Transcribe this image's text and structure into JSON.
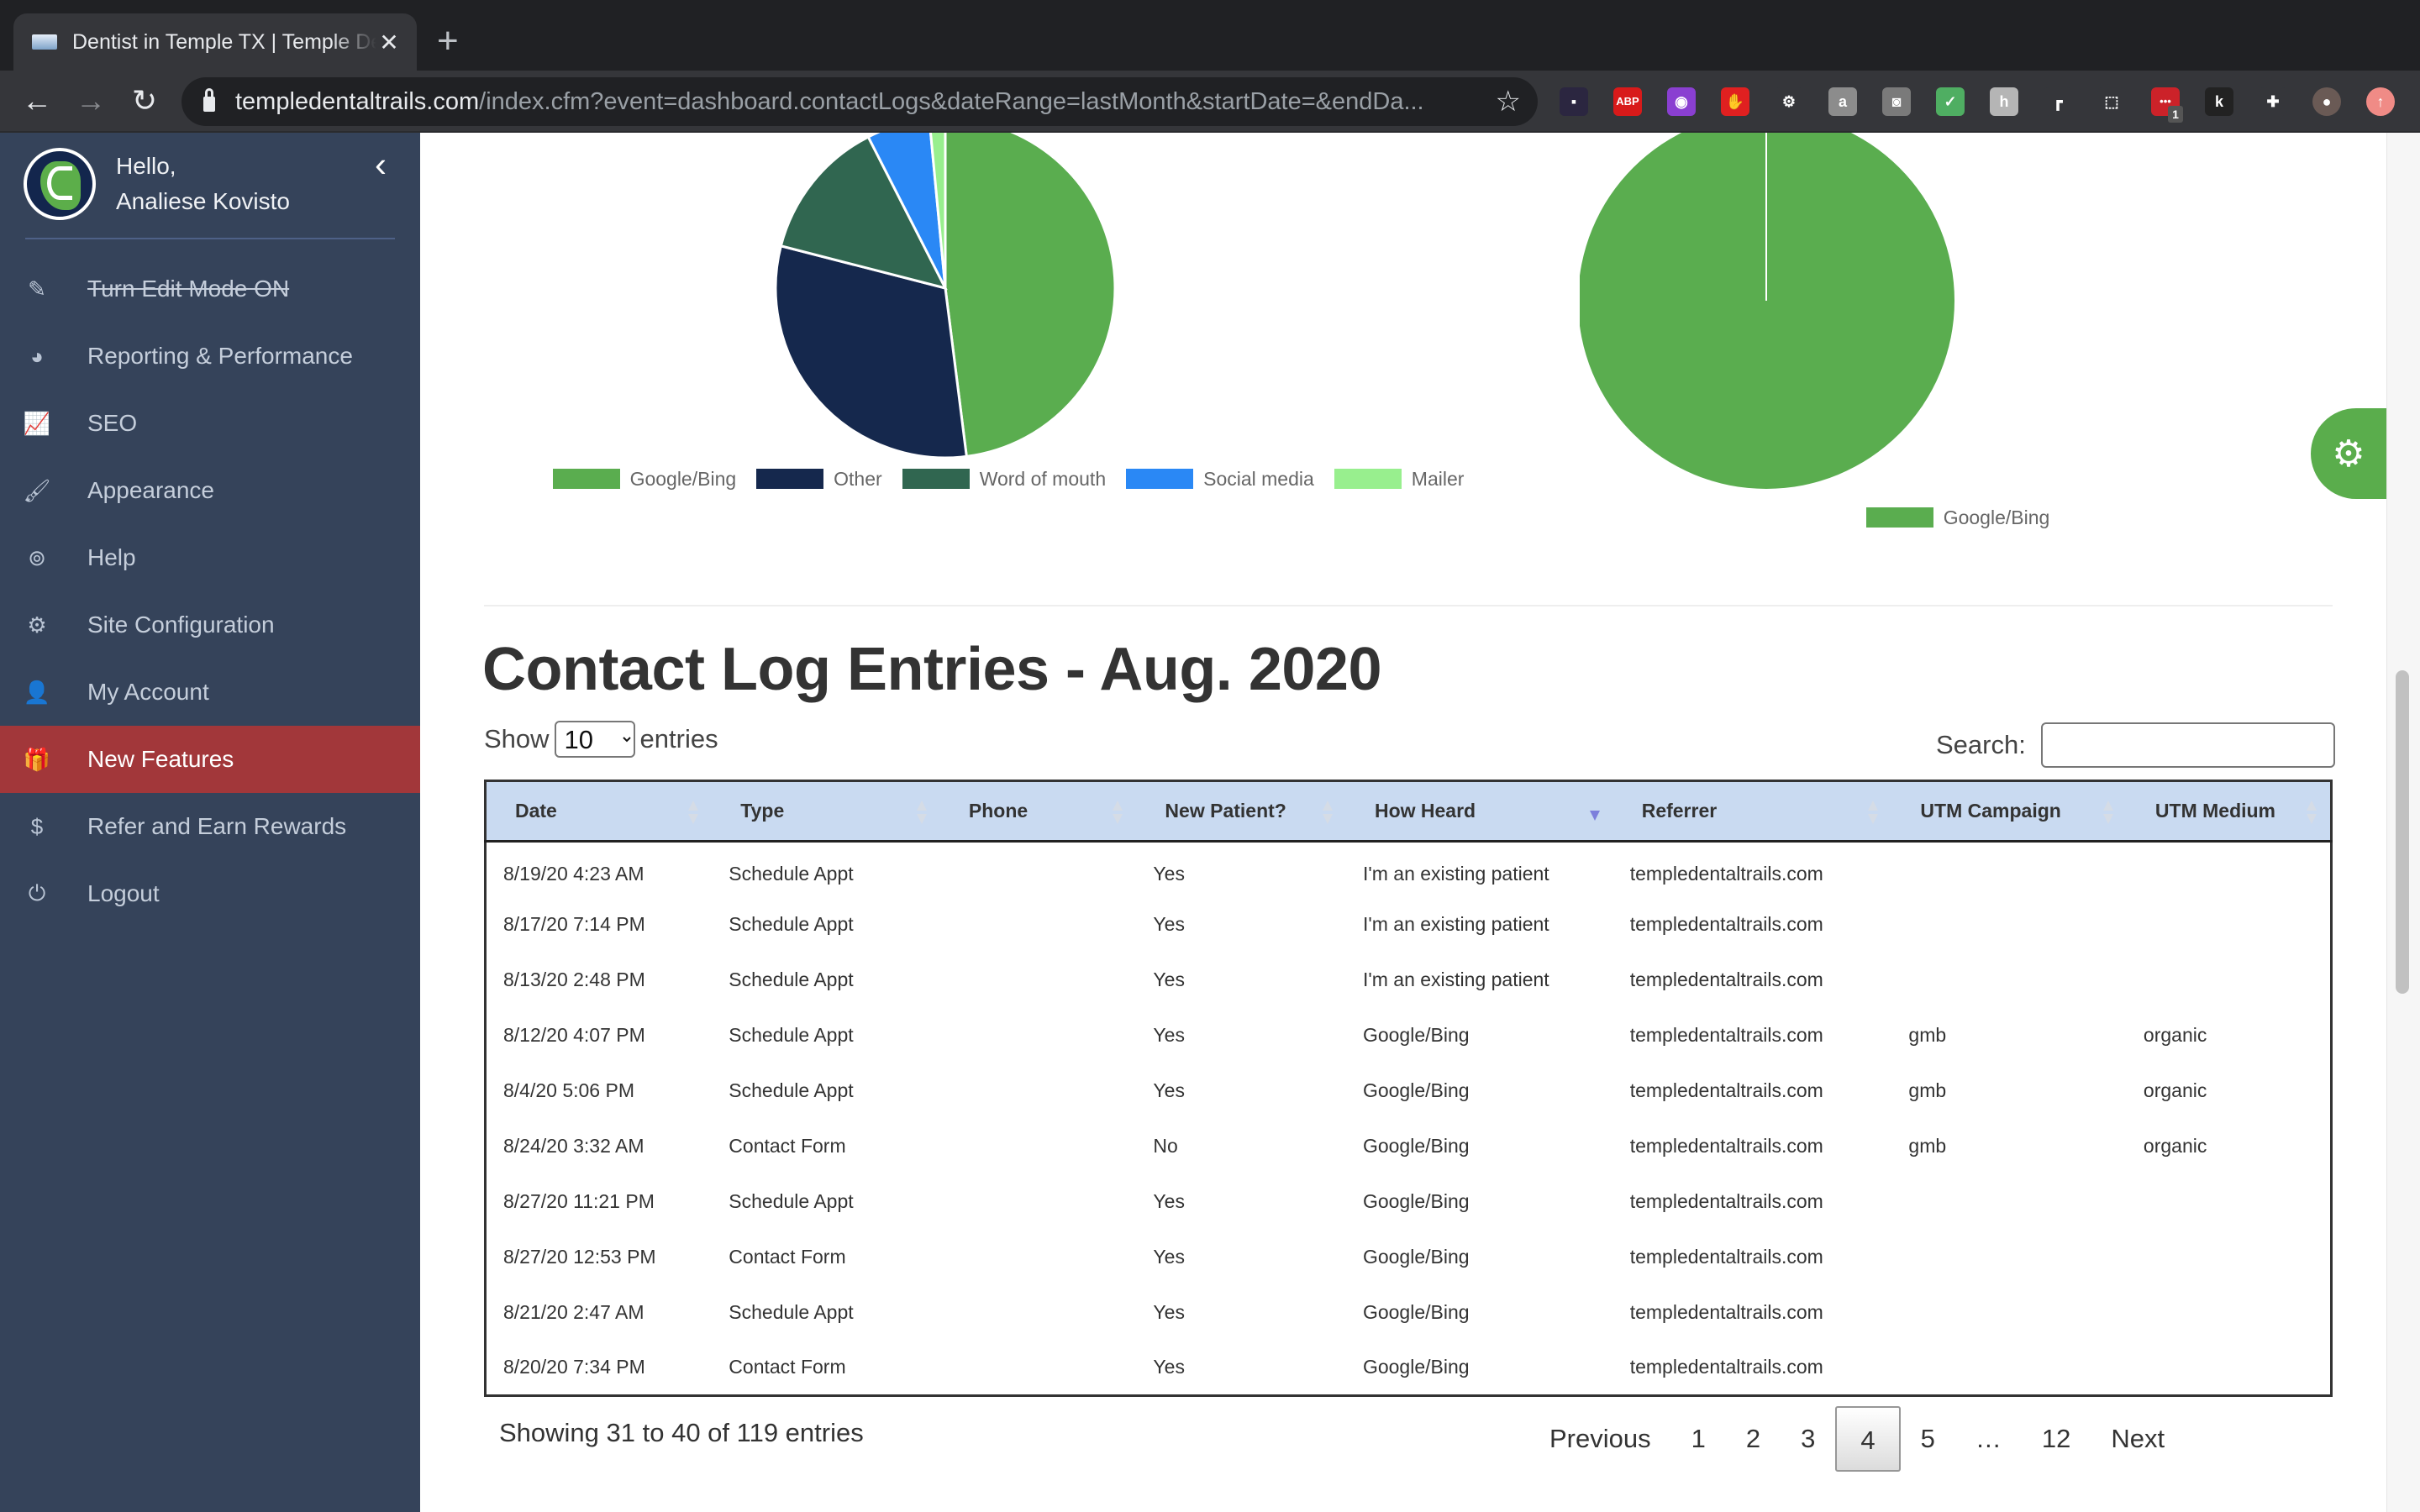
{
  "browser": {
    "tab_title": "Dentist in Temple TX | Temple Dental Trails",
    "tab_close": "✕",
    "new_tab": "+",
    "url_host": "templedentaltrails.com",
    "url_path": "/index.cfm?event=dashboard.contactLogs&dateRange=lastMonth&startDate=&endDa...",
    "back": "←",
    "forward": "→",
    "reload": "↻",
    "bookmark": "☆",
    "extensions": [
      {
        "name": "screen-recorder-icon",
        "glyph": "▪",
        "color": "#2b2640"
      },
      {
        "name": "adblock-plus-icon",
        "glyph": "ABP",
        "color": "#d81a1a"
      },
      {
        "name": "color-picker-icon",
        "glyph": "◉",
        "color": "#8a3fd1"
      },
      {
        "name": "stop-hand-icon",
        "glyph": "✋",
        "color": "#e02020"
      },
      {
        "name": "gear-extension-icon",
        "glyph": "⚙",
        "color": "#35363a"
      },
      {
        "name": "translate-icon",
        "glyph": "a",
        "color": "#8c8c8c"
      },
      {
        "name": "camera-icon",
        "glyph": "◙",
        "color": "#7a7a7a"
      },
      {
        "name": "shield-check-icon",
        "glyph": "✓",
        "color": "#4fae62"
      },
      {
        "name": "script-h-icon",
        "glyph": "h",
        "color": "#b5b5b5"
      },
      {
        "name": "signpost-icon",
        "glyph": "┏",
        "color": "#35363a"
      },
      {
        "name": "selection-icon",
        "glyph": "⬚",
        "color": "#35363a"
      },
      {
        "name": "lastpass-icon",
        "glyph": "•••",
        "color": "#cc2229",
        "badge": "1"
      },
      {
        "name": "k-extension-icon",
        "glyph": "k",
        "color": "#222"
      },
      {
        "name": "puzzle-extensions-icon",
        "glyph": "✚",
        "color": "#35363a"
      },
      {
        "name": "profile-avatar-icon",
        "glyph": "●",
        "color": "#6a5a55"
      },
      {
        "name": "update-arrow-icon",
        "glyph": "↑",
        "color": "#f08b86"
      }
    ]
  },
  "sidebar": {
    "greeting": "Hello,",
    "user_name": "Analiese Kovisto",
    "collapse": "‹",
    "items": [
      {
        "label": "Turn Edit Mode ON",
        "icon": "✎",
        "icon_name": "pencil-icon",
        "strike": true
      },
      {
        "label": "Reporting & Performance",
        "icon": "◕",
        "icon_name": "pie-chart-icon"
      },
      {
        "label": "SEO",
        "icon": "📈",
        "icon_name": "line-chart-icon"
      },
      {
        "label": "Appearance",
        "icon": "🖌",
        "icon_name": "paint-brush-icon"
      },
      {
        "label": "Help",
        "icon": "⊚",
        "icon_name": "life-ring-icon"
      },
      {
        "label": "Site Configuration",
        "icon": "⚙",
        "icon_name": "gear-icon"
      },
      {
        "label": "My Account",
        "icon": "👤",
        "icon_name": "user-icon"
      },
      {
        "label": "New Features",
        "icon": "🎁",
        "icon_name": "gift-icon",
        "active": true
      },
      {
        "label": "Refer and Earn Rewards",
        "icon": "$",
        "icon_name": "dollar-icon"
      },
      {
        "label": "Logout",
        "icon": "⏻",
        "icon_name": "power-icon"
      }
    ]
  },
  "colors": {
    "sidebar_bg": "#35435a",
    "active_item": "#a2373a",
    "table_header": "#c9daf1",
    "gear_tab": "#5aad4c"
  },
  "chart_data": [
    {
      "type": "pie",
      "title": "",
      "legend_position": "bottom",
      "categories": [
        "Google/Bing",
        "Other",
        "Word of mouth",
        "Social media",
        "Mailer"
      ],
      "values": [
        48,
        31,
        13.5,
        6,
        1.5
      ],
      "colors": [
        "#5aad4f",
        "#15284d",
        "#306650",
        "#2a88f5",
        "#98ef8e"
      ]
    },
    {
      "type": "pie",
      "title": "",
      "legend_position": "bottom",
      "categories": [
        "Google/Bing"
      ],
      "values": [
        100
      ],
      "colors": [
        "#5aad4f"
      ]
    }
  ],
  "gear_tab_icon": "⚙",
  "section": {
    "title": "Contact Log Entries - Aug. 2020",
    "show_label": "Show",
    "entries_label": "entries",
    "page_length": "10",
    "search_label": "Search:",
    "search_value": "",
    "search_placeholder": ""
  },
  "table": {
    "columns": [
      "Date",
      "Type",
      "Phone",
      "New Patient?",
      "How Heard",
      "Referrer",
      "UTM Campaign",
      "UTM Medium"
    ],
    "sorted_column": "How Heard",
    "sort_direction": "desc",
    "rows": [
      [
        "8/19/20 4:23 AM",
        "Schedule Appt",
        "",
        "Yes",
        "I'm an existing patient",
        "templedentaltrails.com",
        "",
        ""
      ],
      [
        "8/17/20 7:14 PM",
        "Schedule Appt",
        "",
        "Yes",
        "I'm an existing patient",
        "templedentaltrails.com",
        "",
        ""
      ],
      [
        "8/13/20 2:48 PM",
        "Schedule Appt",
        "",
        "Yes",
        "I'm an existing patient",
        "templedentaltrails.com",
        "",
        ""
      ],
      [
        "8/12/20 4:07 PM",
        "Schedule Appt",
        "",
        "Yes",
        "Google/Bing",
        "templedentaltrails.com",
        "gmb",
        "organic"
      ],
      [
        "8/4/20 5:06 PM",
        "Schedule Appt",
        "",
        "Yes",
        "Google/Bing",
        "templedentaltrails.com",
        "gmb",
        "organic"
      ],
      [
        "8/24/20 3:32 AM",
        "Contact Form",
        "",
        "No",
        "Google/Bing",
        "templedentaltrails.com",
        "gmb",
        "organic"
      ],
      [
        "8/27/20 11:21 PM",
        "Schedule Appt",
        "",
        "Yes",
        "Google/Bing",
        "templedentaltrails.com",
        "",
        ""
      ],
      [
        "8/27/20 12:53 PM",
        "Contact Form",
        "",
        "Yes",
        "Google/Bing",
        "templedentaltrails.com",
        "",
        ""
      ],
      [
        "8/21/20 2:47 AM",
        "Schedule Appt",
        "",
        "Yes",
        "Google/Bing",
        "templedentaltrails.com",
        "",
        ""
      ],
      [
        "8/20/20 7:34 PM",
        "Contact Form",
        "",
        "Yes",
        "Google/Bing",
        "templedentaltrails.com",
        "",
        ""
      ]
    ]
  },
  "pagination": {
    "info": "Showing 31 to 40 of 119 entries",
    "previous": "Previous",
    "next": "Next",
    "pages": [
      "1",
      "2",
      "3",
      "4",
      "5",
      "…",
      "12"
    ],
    "current": "4"
  }
}
